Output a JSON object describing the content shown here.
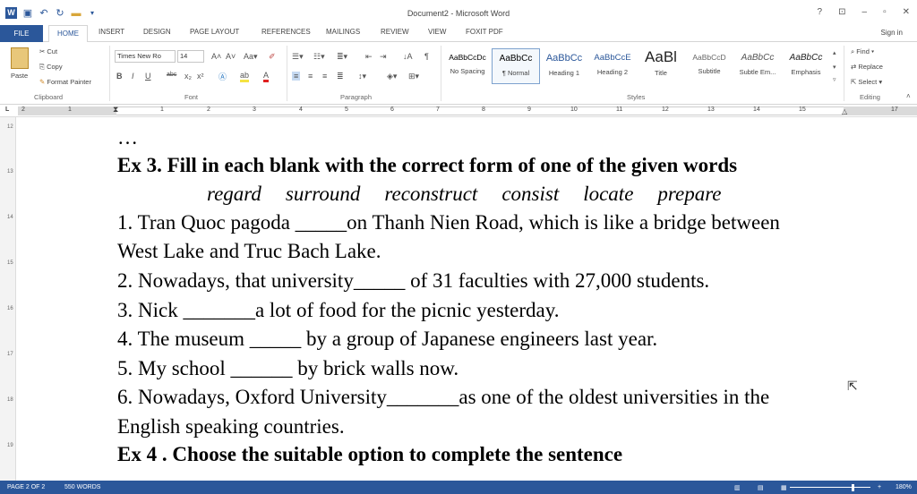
{
  "window": {
    "title": "Document2 - Microsoft Word",
    "controls": [
      "?",
      "⊡",
      "–",
      "▫",
      "✕"
    ],
    "signin": "Sign in"
  },
  "tabs": [
    "FILE",
    "HOME",
    "INSERT",
    "DESIGN",
    "PAGE LAYOUT",
    "REFERENCES",
    "MAILINGS",
    "REVIEW",
    "VIEW",
    "FOXIT PDF"
  ],
  "ribbon": {
    "clipboard": {
      "paste": "Paste",
      "cut": "Cut",
      "copy": "Copy",
      "format_painter": "Format Painter",
      "label": "Clipboard"
    },
    "font": {
      "family": "Times New Ro",
      "size": "14",
      "label": "Font"
    },
    "paragraph": {
      "label": "Paragraph"
    },
    "styles": {
      "label": "Styles",
      "items": [
        {
          "sample": "AaBbCcDc",
          "name": "No Spacing"
        },
        {
          "sample": "AaBbCc",
          "name": "¶ Normal"
        },
        {
          "sample": "AaBbCc",
          "name": "Heading 1"
        },
        {
          "sample": "AaBbCcE",
          "name": "Heading 2"
        },
        {
          "sample": "AaBl",
          "name": "Title"
        },
        {
          "sample": "AaBbCcD",
          "name": "Subtitle"
        },
        {
          "sample": "AaBbCc",
          "name": "Subtle Em..."
        },
        {
          "sample": "AaBbCc",
          "name": "Emphasis"
        }
      ]
    },
    "editing": {
      "find": "Find",
      "replace": "Replace",
      "select": "Select",
      "label": "Editing"
    }
  },
  "ruler": {
    "numbers": [
      "2",
      "1",
      "1",
      "2",
      "3",
      "4",
      "5",
      "6",
      "7",
      "8",
      "9",
      "10",
      "11",
      "12",
      "13",
      "14",
      "15",
      "17"
    ],
    "side_numbers": [
      "12",
      "13",
      "14",
      "15",
      "16",
      "17",
      "18",
      "19"
    ]
  },
  "document": {
    "ellipsis": "…",
    "ex3_title": "Ex 3. Fill in each blank with the correct form of one of the given words",
    "words": [
      "regard",
      "surround",
      "reconstruct",
      "consist",
      "locate",
      "prepare"
    ],
    "lines": [
      "1. Tran Quoc pagoda _____on Thanh Nien Road, which is like a bridge between",
      "West Lake and Truc Bach Lake.",
      "2. Nowadays, that university_____ of 31 faculties with 27,000 students.",
      "3. Nick _______a lot of food for the picnic yesterday.",
      "4. The museum _____ by a group of Japanese engineers last year.",
      "5. My school ______ by brick walls now.",
      "6. Nowadays, Oxford University_______as one of the oldest universities in the",
      "English speaking countries."
    ],
    "ex4_title": "Ex 4 . Choose the suitable option to complete the sentence"
  },
  "status": {
    "page": "PAGE 2 OF 2",
    "words": "550 WORDS",
    "zoom": "180%"
  }
}
